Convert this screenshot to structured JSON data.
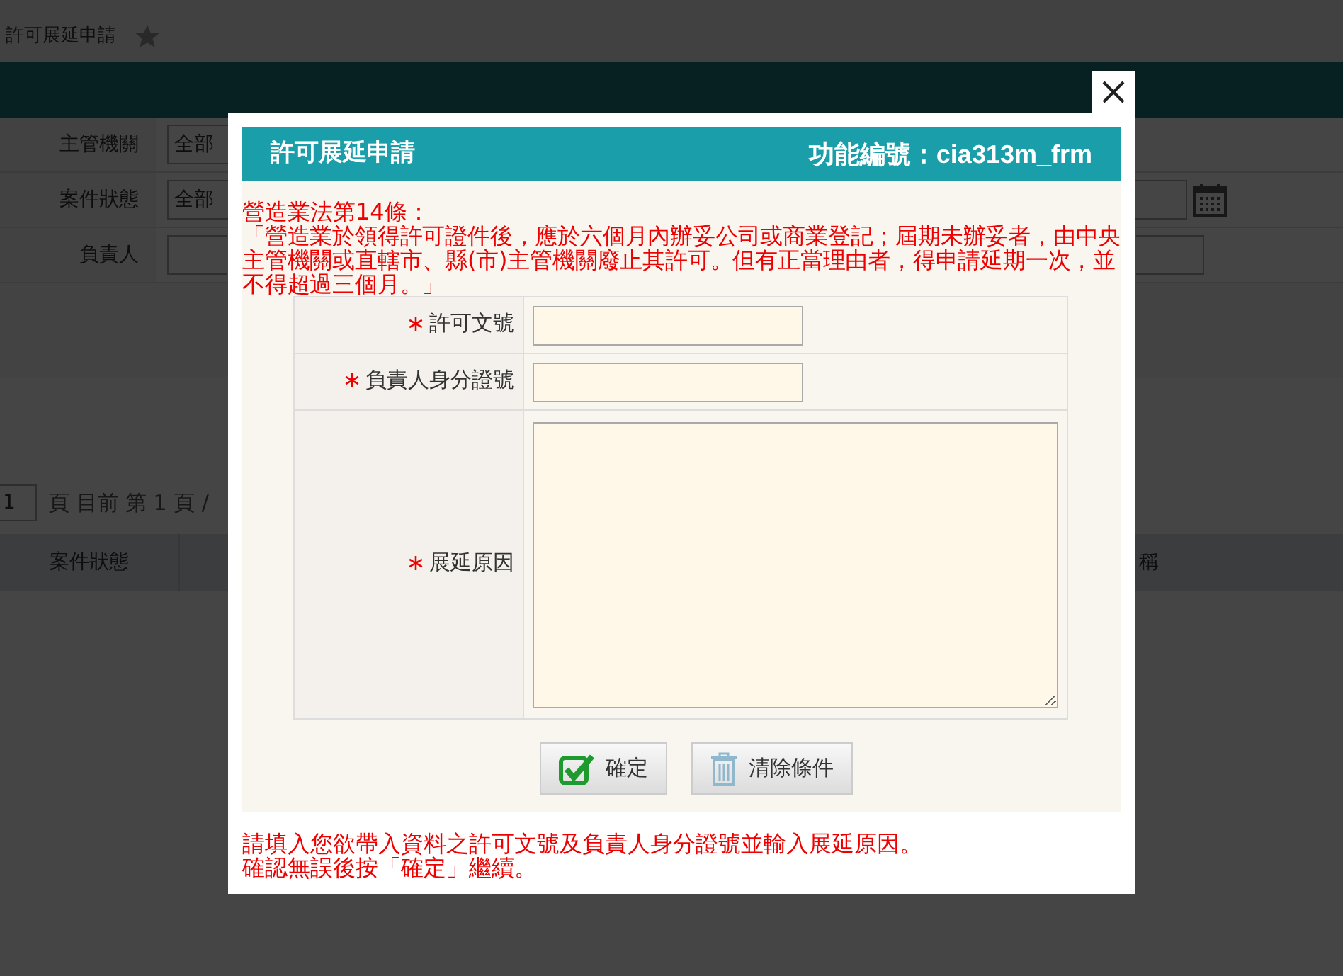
{
  "background": {
    "page_title": "許可展延申請",
    "filters": [
      {
        "label": "主管機關",
        "kind": "select",
        "value": "全部"
      },
      {
        "label": "案件狀態",
        "kind": "select",
        "value": "全部",
        "side_field": {
          "kind": "date"
        }
      },
      {
        "label": "負責人",
        "kind": "input",
        "side_field": {
          "kind": "input"
        }
      }
    ],
    "pagination": {
      "page": "1",
      "text": "頁 目前 第 1 頁 /"
    },
    "table_columns": [
      "案件狀態",
      "稱"
    ]
  },
  "dialog": {
    "title": "許可展延申請",
    "function_code": "功能編號：cia313m_frm",
    "law_title": "營造業法第14條：",
    "law_text": "「營造業於領得許可證件後，應於六個月內辦妥公司或商業登記；屆期未辦妥者，由中央主管機關或直轄市、縣(市)主管機關廢止其許可。但有正當理由者，得申請延期一次，並不得超過三個月。」",
    "fields": [
      {
        "label": "許可文號",
        "required": true,
        "kind": "text"
      },
      {
        "label": "負責人身分證號",
        "required": true,
        "kind": "text"
      },
      {
        "label": "展延原因",
        "required": true,
        "kind": "textarea"
      }
    ],
    "buttons": [
      {
        "label": "確定",
        "kind": "confirm"
      },
      {
        "label": "清除條件",
        "kind": "clear"
      }
    ],
    "notes": [
      "請填入您欲帶入資料之許可文號及負責人身分證號並輸入展延原因。",
      "確認無誤後按「確定」繼續。"
    ]
  }
}
